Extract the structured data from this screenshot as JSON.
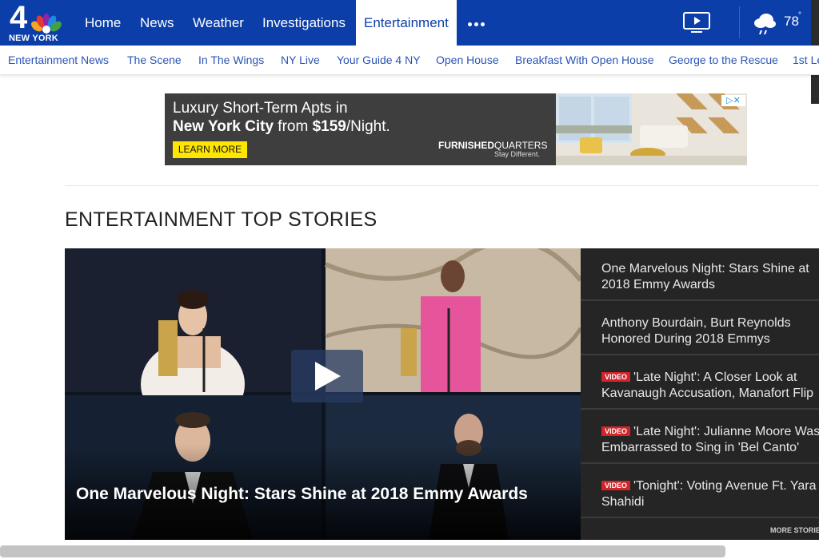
{
  "brand": {
    "logo_number": "4",
    "logo_city": "NEW YORK"
  },
  "nav": {
    "items": [
      {
        "label": "Home"
      },
      {
        "label": "News"
      },
      {
        "label": "Weather"
      },
      {
        "label": "Investigations"
      },
      {
        "label": "Entertainment",
        "active": true
      }
    ],
    "more_icon": "more-dots-icon",
    "tv_icon": "tv-play-icon",
    "weather": {
      "icon": "rain-cloud-icon",
      "temperature": "78",
      "unit": "°"
    }
  },
  "subnav": {
    "items": [
      "Entertainment News",
      "The Scene",
      "In The Wings",
      "NY Live",
      "Your Guide 4 NY",
      "Open House",
      "Breakfast With Open House",
      "George to the Rescue",
      "1st Le"
    ]
  },
  "ad": {
    "line1": "Luxury Short-Term Apts in",
    "line2_bold1": "New York City",
    "line2_mid": " from ",
    "line2_bold2": "$159",
    "line2_end": "/Night.",
    "cta": "LEARN MORE",
    "brand_bold": "FURNISHED",
    "brand_thin": "QUARTERS",
    "tagline": "Stay Different.",
    "adchoices": "▷✕"
  },
  "section": {
    "title": "ENTERTAINMENT TOP STORIES"
  },
  "hero": {
    "caption": "One Marvelous Night: Stars Shine at 2018 Emmy Awards"
  },
  "stories": [
    {
      "video": false,
      "badge": "",
      "line1": "One Marvelous Night: Stars Shine at",
      "line2": "2018 Emmy Awards"
    },
    {
      "video": false,
      "badge": "",
      "line1": "Anthony Bourdain, Burt Reynolds",
      "line2": "Honored During 2018 Emmys"
    },
    {
      "video": true,
      "badge": "VIDEO",
      "line1": "'Late Night': A Closer Look at",
      "line2": "Kavanaugh Accusation, Manafort Flip"
    },
    {
      "video": true,
      "badge": "VIDEO",
      "line1": "'Late Night': Julianne Moore Was",
      "line2": "Embarrassed to Sing in 'Bel Canto'"
    },
    {
      "video": true,
      "badge": "VIDEO",
      "line1": "'Tonight': Voting Avenue Ft. Yara",
      "line2": "Shahidi"
    }
  ],
  "more_stories": "MORE STORIES",
  "colors": {
    "nav_blue": "#0b3ea8",
    "link_blue": "#2a55b6",
    "video_red": "#d2252a",
    "ad_yellow": "#ffe600"
  }
}
